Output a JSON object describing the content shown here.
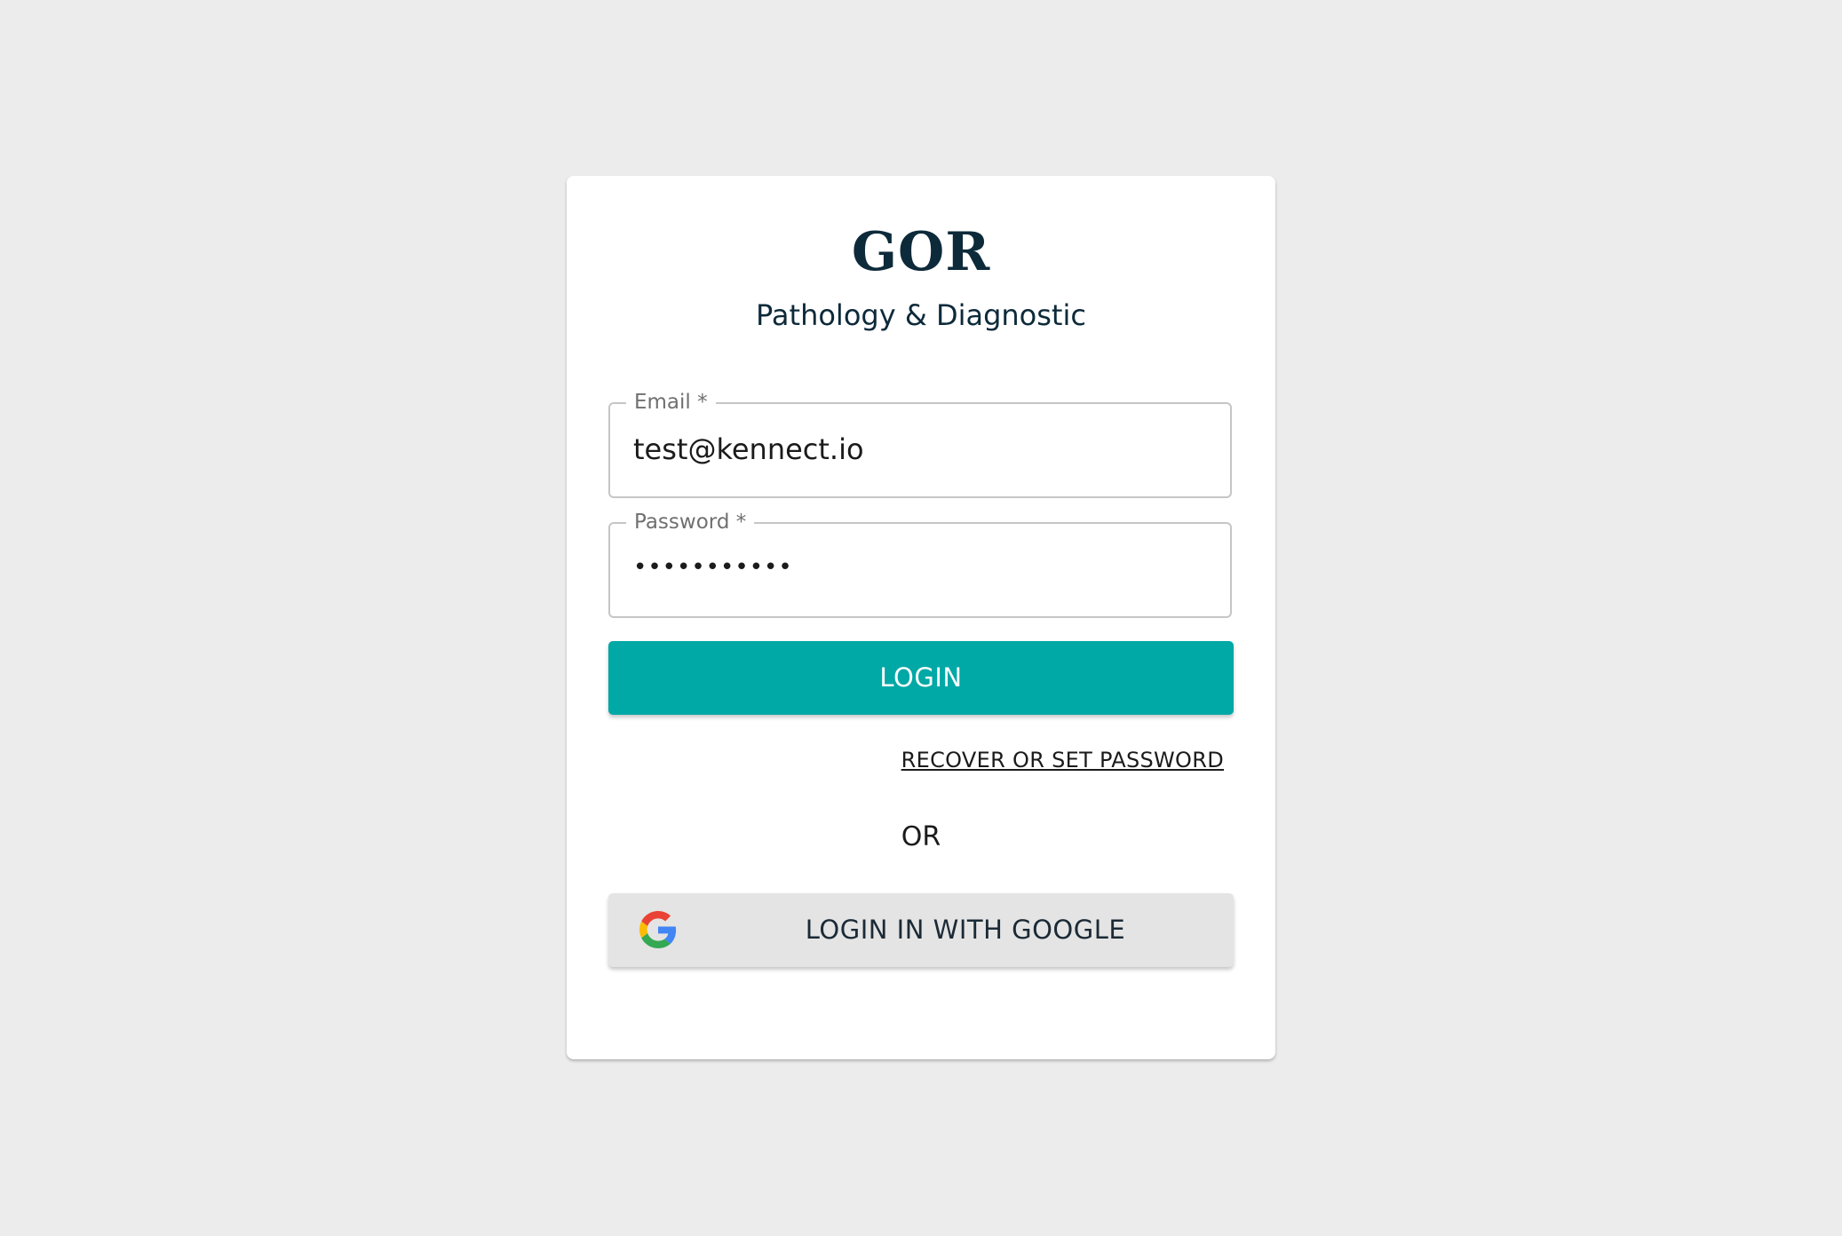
{
  "brand": {
    "logo": "GOR",
    "subtitle": "Pathology & Diagnostic"
  },
  "form": {
    "email": {
      "label": "Email *",
      "value": "test@kennect.io"
    },
    "password": {
      "label": "Password *",
      "masked_value": "•••••••••••"
    },
    "login_label": "LOGIN",
    "recover_label": "RECOVER OR SET PASSWORD",
    "separator": "OR",
    "google_label": "LOGIN IN WITH GOOGLE"
  },
  "icons": {
    "google": "google-g-icon"
  },
  "colors": {
    "background": "#ececec",
    "brand_text": "#0d2a3a",
    "primary": "#00a8a6",
    "google_button": "#e4e4e4"
  }
}
